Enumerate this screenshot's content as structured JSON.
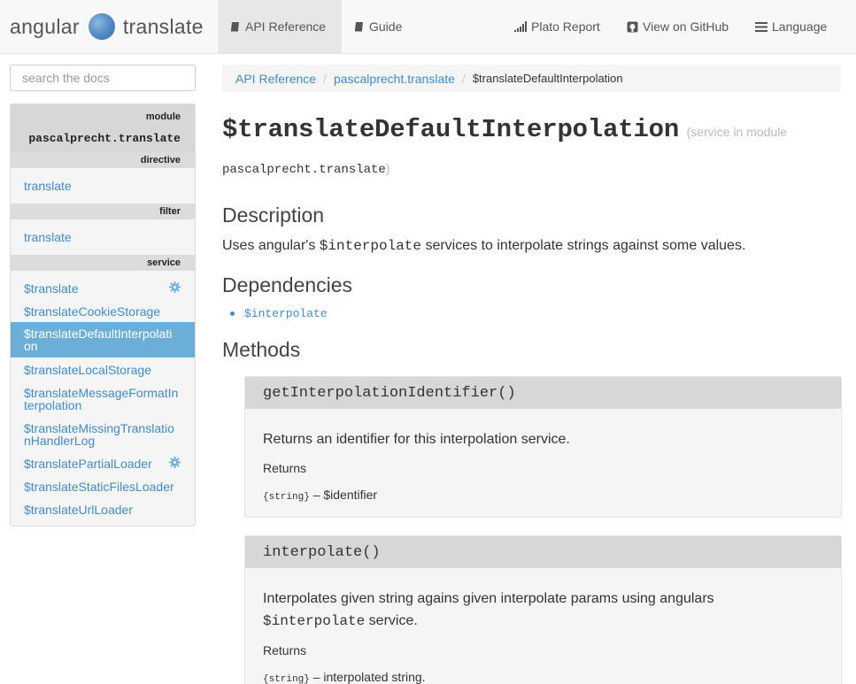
{
  "navbar": {
    "brand_left": "angular",
    "brand_right": "translate",
    "items": [
      {
        "label": "API Reference",
        "icon": "book-icon"
      },
      {
        "label": "Guide",
        "icon": "book-icon"
      },
      {
        "label": "Plato Report",
        "icon": "signal-icon"
      },
      {
        "label": "View on GitHub",
        "icon": "github-icon"
      },
      {
        "label": "Language",
        "icon": "list-icon"
      }
    ]
  },
  "sidebar": {
    "search_placeholder": "search the docs",
    "module_label": "module",
    "module_name": "pascalprecht.translate",
    "directive_label": "directive",
    "directive_items": [
      "translate"
    ],
    "filter_label": "filter",
    "filter_items": [
      "translate"
    ],
    "service_label": "service",
    "service_items": [
      "$translate",
      "$translateCookieStorage",
      "$translateDefaultInterpolati on",
      "$translateLocalStorage",
      "$translateMessageFormatIn terpolation",
      "$translateMissingTranslatio nHandlerLog",
      "$translatePartialLoader",
      "$translateStaticFilesLoader",
      "$translateUrlLoader"
    ]
  },
  "breadcrumb": {
    "items": [
      "API Reference",
      "pascalprecht.translate"
    ],
    "current": "$translateDefaultInterpolation",
    "separator": "/"
  },
  "content": {
    "title": "$translateDefaultInterpolation",
    "title_meta": "(service in module",
    "module_name": "pascalprecht.translate",
    "module_close": ")",
    "description_heading": "Description",
    "description_pre": "Uses angular's ",
    "description_code": "$interpolate",
    "description_post": " services to interpolate strings against some values.",
    "dependencies_heading": "Dependencies",
    "dependencies": [
      "$interpolate"
    ],
    "methods_heading": "Methods",
    "methods": [
      {
        "name": "getInterpolationIdentifier()",
        "desc_line1": "Returns an identifier for this interpolation service.",
        "desc_code": "",
        "desc_line2": "",
        "returns_label": "Returns",
        "return_type": "{string}",
        "return_desc": "– $identifier"
      },
      {
        "name": "interpolate()",
        "desc_line1": "Interpolates given string agains given interpolate params using angulars",
        "desc_code": "$interpolate",
        "desc_line2": " service.",
        "returns_label": "Returns",
        "return_type": "{string}",
        "return_desc": "– interpolated string."
      }
    ]
  },
  "colors": {
    "link": "#428bca",
    "active_sidebar": "#6baed8",
    "navbar_bg": "#f8f8f8"
  }
}
